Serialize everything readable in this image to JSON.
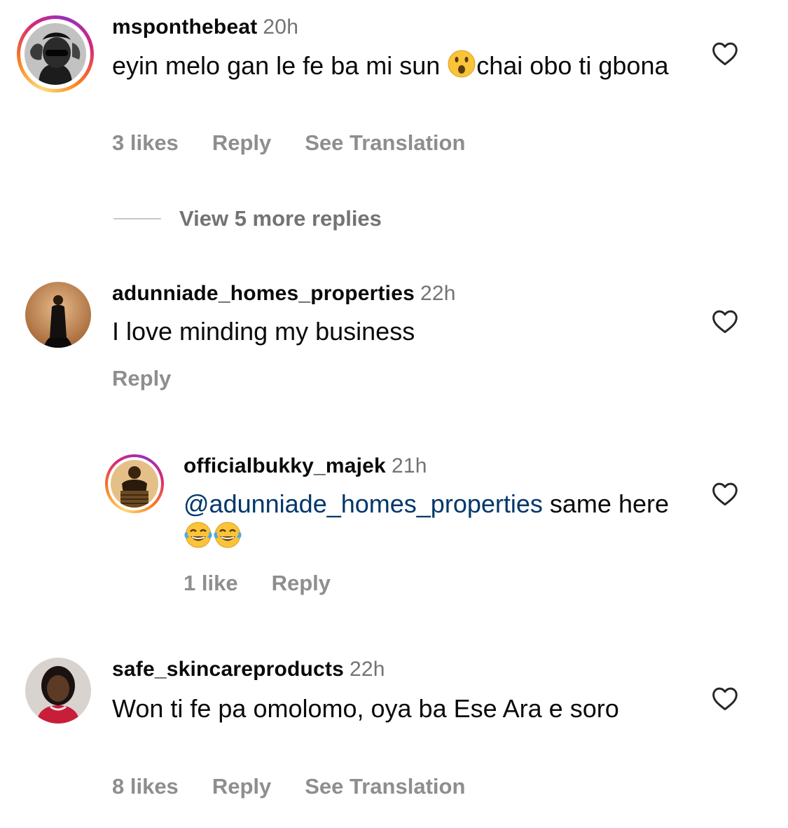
{
  "comments": [
    {
      "username": "msponthebeat",
      "time": "20h",
      "text_before": "eyin melo gan le fe ba mi sun ",
      "emoji": "surprised-face",
      "text_after": "chai obo ti gbona",
      "likes": "3 likes",
      "reply": "Reply",
      "translate": "See Translation",
      "story_ring": true
    },
    {
      "username": "adunniade_homes_properties",
      "time": "22h",
      "text": "I love minding my business",
      "reply": "Reply",
      "story_ring": false
    },
    {
      "username": "officialbukky_majek",
      "time": "21h",
      "mention": "@adunniade_homes_properties",
      "text": " same here ",
      "emojis": [
        "face-with-tears-of-joy",
        "face-with-tears-of-joy"
      ],
      "likes": "1 like",
      "reply": "Reply",
      "story_ring": true,
      "is_reply": true
    },
    {
      "username": "safe_skincareproducts",
      "time": "22h",
      "text": "Won ti fe pa omolomo, oya ba Ese Ara e soro",
      "likes": "8 likes",
      "reply": "Reply",
      "translate": "See Translation",
      "story_ring": false
    }
  ],
  "view_more": "View 5 more replies",
  "colors": {
    "mention": "#00376b",
    "meta": "#8e8e8e",
    "time": "#737373"
  },
  "icons": {
    "like": "heart-outline-icon"
  }
}
